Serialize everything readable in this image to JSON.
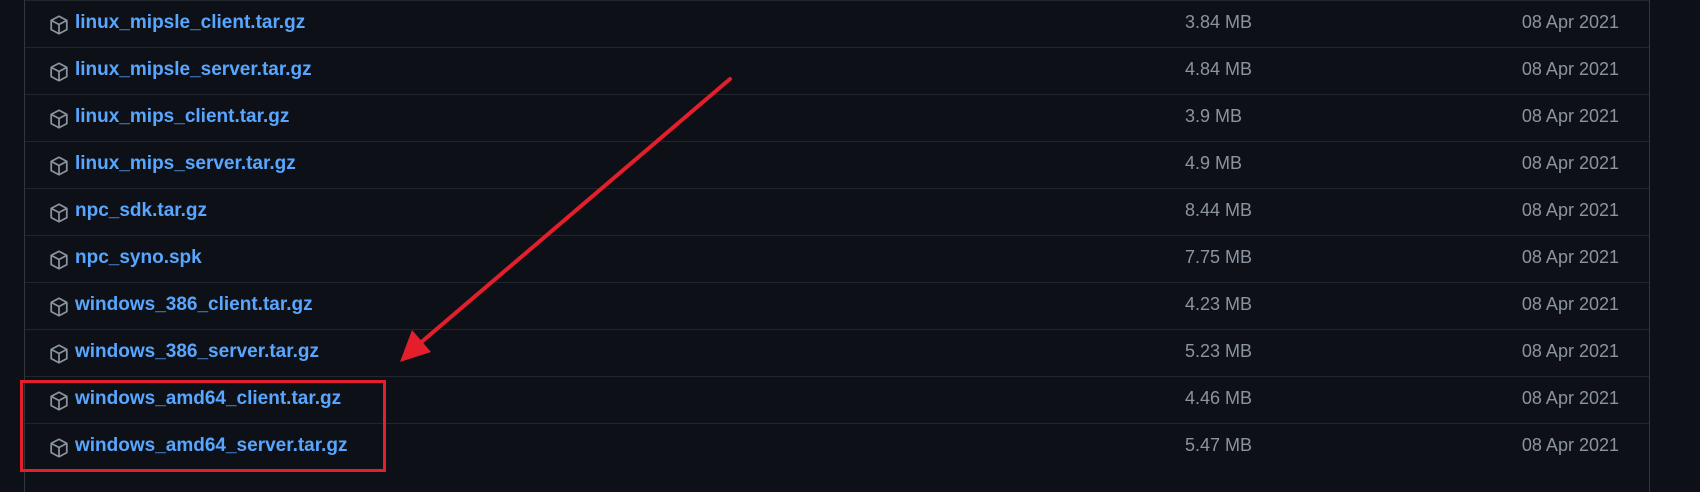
{
  "assets": [
    {
      "name": "linux_mipsle_client.tar.gz",
      "size": "3.84 MB",
      "date": "08 Apr 2021"
    },
    {
      "name": "linux_mipsle_server.tar.gz",
      "size": "4.84 MB",
      "date": "08 Apr 2021"
    },
    {
      "name": "linux_mips_client.tar.gz",
      "size": "3.9 MB",
      "date": "08 Apr 2021"
    },
    {
      "name": "linux_mips_server.tar.gz",
      "size": "4.9 MB",
      "date": "08 Apr 2021"
    },
    {
      "name": "npc_sdk.tar.gz",
      "size": "8.44 MB",
      "date": "08 Apr 2021"
    },
    {
      "name": "npc_syno.spk",
      "size": "7.75 MB",
      "date": "08 Apr 2021"
    },
    {
      "name": "windows_386_client.tar.gz",
      "size": "4.23 MB",
      "date": "08 Apr 2021"
    },
    {
      "name": "windows_386_server.tar.gz",
      "size": "5.23 MB",
      "date": "08 Apr 2021"
    },
    {
      "name": "windows_amd64_client.tar.gz",
      "size": "4.46 MB",
      "date": "08 Apr 2021"
    },
    {
      "name": "windows_amd64_server.tar.gz",
      "size": "5.47 MB",
      "date": "08 Apr 2021"
    }
  ],
  "icons": {
    "package": "package-icon"
  },
  "colors": {
    "background": "#0d1117",
    "link": "#58a6ff",
    "muted_text": "#8b949e",
    "row_border": "#21262d",
    "annotation": "#e41e2b"
  }
}
